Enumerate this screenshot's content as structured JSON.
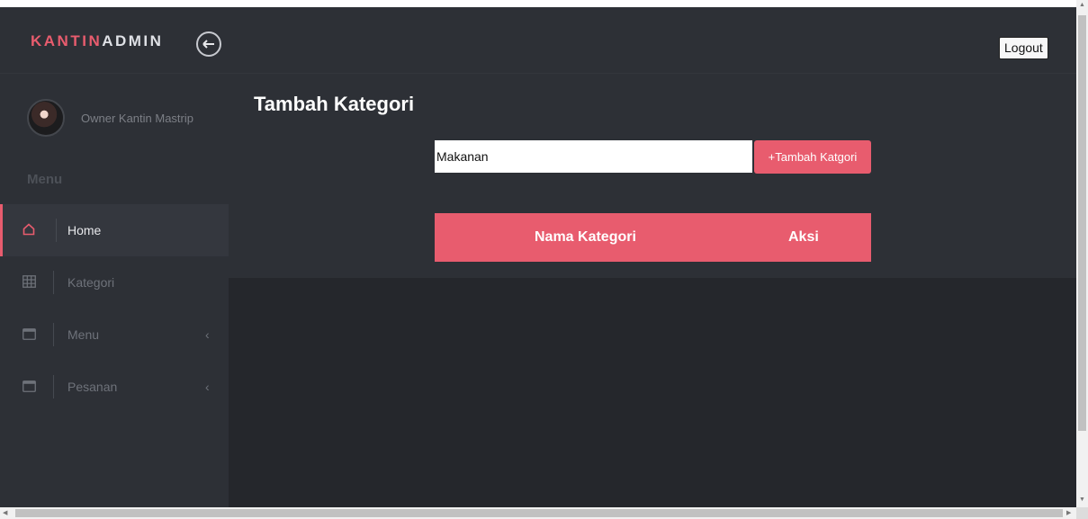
{
  "header": {
    "brand_part1": "KANTIN",
    "brand_part2": "ADMIN",
    "logout_label": "Logout"
  },
  "sidebar": {
    "owner_name": "Owner Kantin Mastrip",
    "menu_title": "Menu",
    "items": [
      {
        "label": "Home",
        "icon": "home-icon",
        "active": true,
        "caret": ""
      },
      {
        "label": "Kategori",
        "icon": "grid-icon",
        "active": false,
        "caret": ""
      },
      {
        "label": "Menu",
        "icon": "window-icon",
        "active": false,
        "caret": "‹"
      },
      {
        "label": "Pesanan",
        "icon": "window-icon",
        "active": false,
        "caret": "‹"
      }
    ]
  },
  "main": {
    "title": "Tambah Kategori",
    "category_input_value": "Makanan",
    "add_button_label": "+Tambah Katgori",
    "table": {
      "columns": [
        "Nama Kategori",
        "Aksi"
      ]
    }
  },
  "colors": {
    "accent": "#e85c6e",
    "panel": "#2d3036",
    "background_dark": "#25272c"
  }
}
